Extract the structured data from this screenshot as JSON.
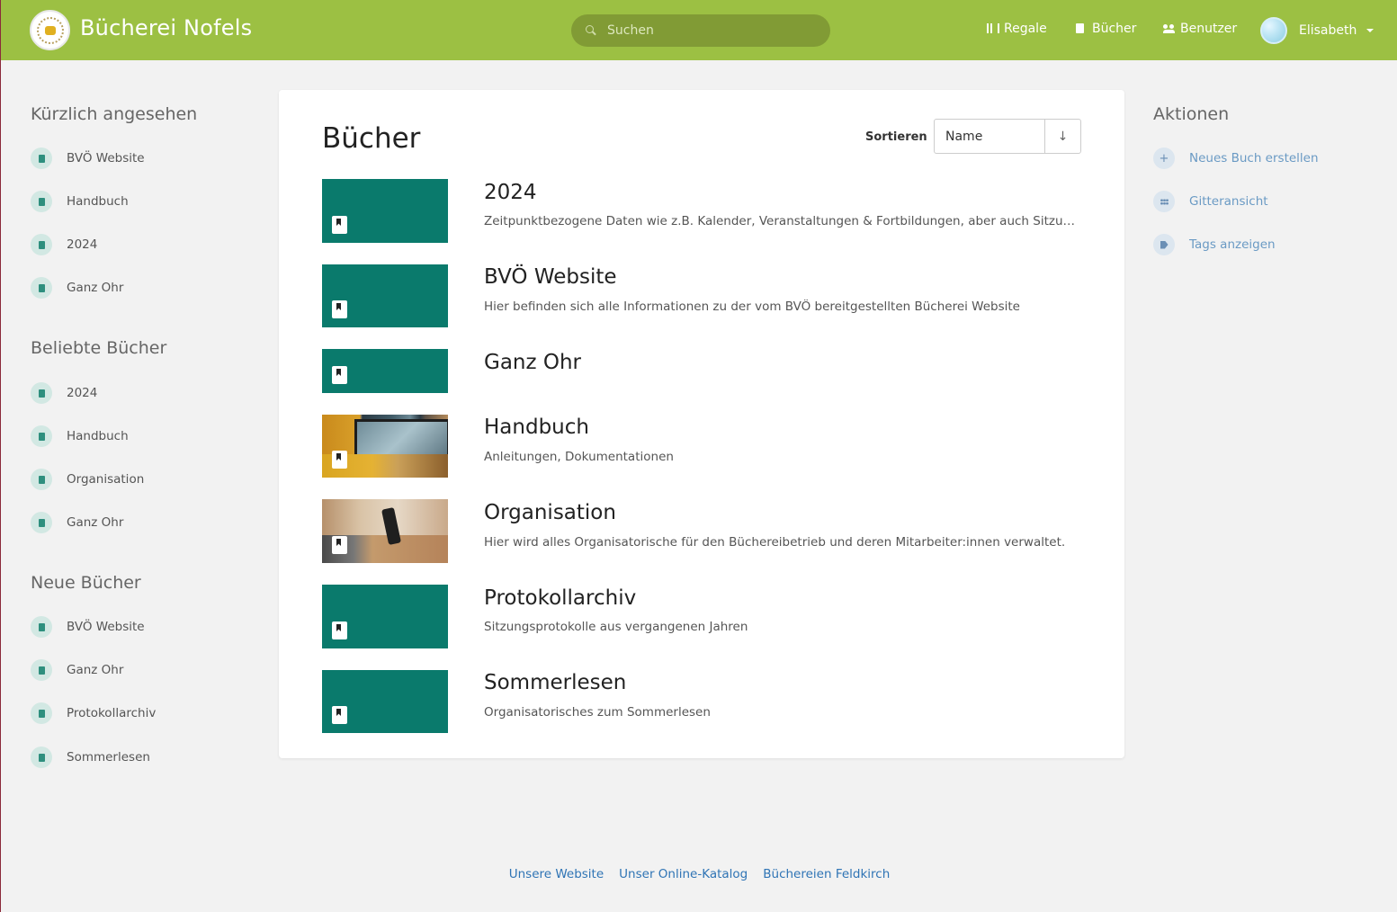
{
  "header": {
    "site_title": "Bücherei Nofels",
    "search_placeholder": "Suchen",
    "nav": [
      {
        "label": "Regale",
        "icon": "shelves-icon"
      },
      {
        "label": "Bücher",
        "icon": "book-icon"
      },
      {
        "label": "Benutzer",
        "icon": "users-icon"
      }
    ],
    "user_name": "Elisabeth"
  },
  "sidebar": {
    "recent": {
      "heading": "Kürzlich angesehen",
      "items": [
        "BVÖ Website",
        "Handbuch",
        "2024",
        "Ganz Ohr"
      ]
    },
    "popular": {
      "heading": "Beliebte Bücher",
      "items": [
        "2024",
        "Handbuch",
        "Organisation",
        "Ganz Ohr"
      ]
    },
    "new": {
      "heading": "Neue Bücher",
      "items": [
        "BVÖ Website",
        "Ganz Ohr",
        "Protokollarchiv",
        "Sommerlesen"
      ]
    }
  },
  "main": {
    "title": "Bücher",
    "sort_label": "Sortieren",
    "sort_value": "Name",
    "sort_direction": "↓",
    "books": [
      {
        "name": "2024",
        "description": "Zeitpunktbezogene Daten wie z.B. Kalender, Veranstaltungen & Fortbildungen, aber auch Sitzungsprotokolle…"
      },
      {
        "name": "BVÖ Website",
        "description": "Hier befinden sich alle Informationen zu der vom BVÖ bereitgestellten Bücherei Website"
      },
      {
        "name": "Ganz Ohr",
        "description": ""
      },
      {
        "name": "Handbuch",
        "description": "Anleitungen, Dokumentationen"
      },
      {
        "name": "Organisation",
        "description": "Hier wird alles Organisatorische für den Büchereibetrieb und deren Mitarbeiter:innen verwaltet."
      },
      {
        "name": "Protokollarchiv",
        "description": "Sitzungsprotokolle aus vergangenen Jahren"
      },
      {
        "name": "Sommerlesen",
        "description": "Organisatorisches zum Sommerlesen"
      }
    ]
  },
  "actions": {
    "heading": "Aktionen",
    "items": [
      {
        "label": "Neues Buch erstellen",
        "icon": "plus-icon"
      },
      {
        "label": "Gitteransicht",
        "icon": "grid-icon"
      },
      {
        "label": "Tags anzeigen",
        "icon": "tag-icon"
      }
    ]
  },
  "footer": {
    "links": [
      "Unsere Website",
      "Unser Online-Katalog",
      "Büchereien Feldkirch"
    ]
  },
  "colors": {
    "header_bg": "#9cc043",
    "book_cover": "#0a7a6c",
    "link": "#2f74b5"
  }
}
